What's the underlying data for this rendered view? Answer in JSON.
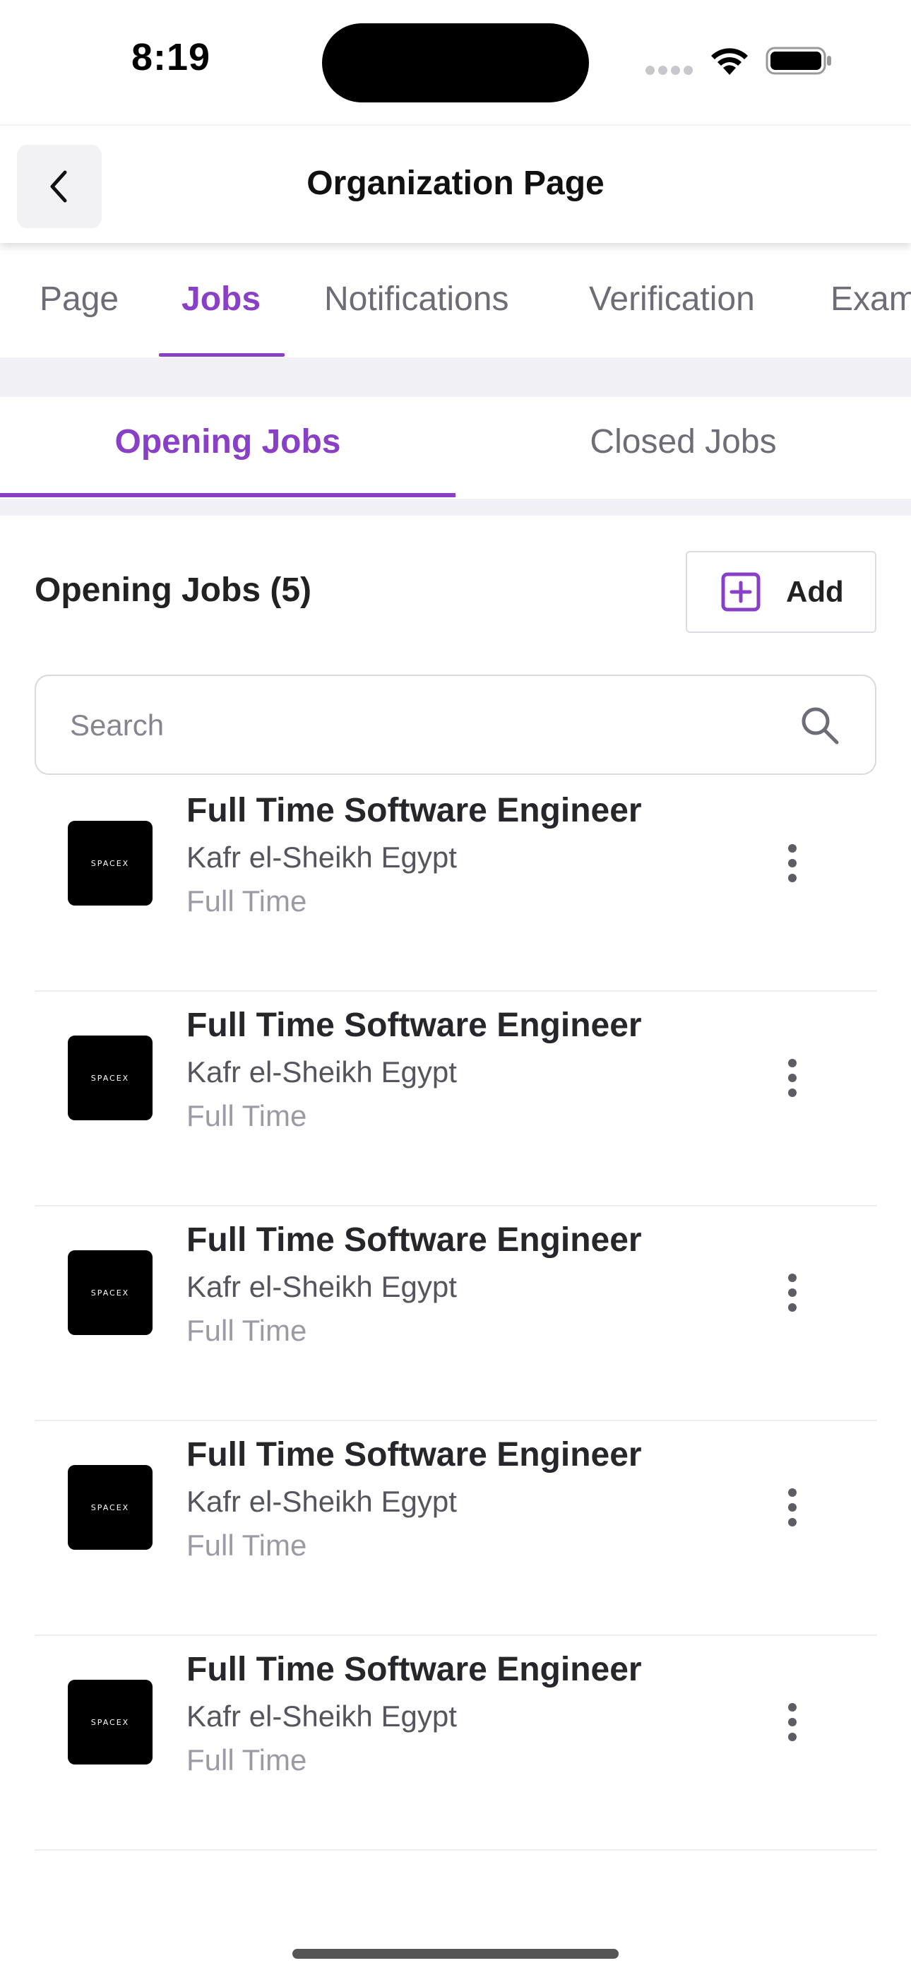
{
  "status_bar": {
    "time": "8:19"
  },
  "header": {
    "title": "Organization Page"
  },
  "primary_tabs": [
    {
      "label": "Page",
      "active": false
    },
    {
      "label": "Jobs",
      "active": true
    },
    {
      "label": "Notifications",
      "active": false
    },
    {
      "label": "Verification",
      "active": false
    },
    {
      "label": "Exam",
      "active": false
    }
  ],
  "secondary_tabs": [
    {
      "label": "Opening Jobs",
      "active": true
    },
    {
      "label": "Closed Jobs",
      "active": false
    }
  ],
  "section": {
    "title": "Opening Jobs (5)",
    "add_label": "Add"
  },
  "search": {
    "placeholder": "Search",
    "value": ""
  },
  "jobs": [
    {
      "title": "Full Time Software Engineer",
      "location": "Kafr el-Sheikh Egypt",
      "type": "Full Time",
      "logo_text": "SPACEX"
    },
    {
      "title": "Full Time Software Engineer",
      "location": "Kafr el-Sheikh Egypt",
      "type": "Full Time",
      "logo_text": "SPACEX"
    },
    {
      "title": "Full Time Software Engineer",
      "location": "Kafr el-Sheikh Egypt",
      "type": "Full Time",
      "logo_text": "SPACEX"
    },
    {
      "title": "Full Time Software Engineer",
      "location": "Kafr el-Sheikh Egypt",
      "type": "Full Time",
      "logo_text": "SPACEX"
    },
    {
      "title": "Full Time Software Engineer",
      "location": "Kafr el-Sheikh Egypt",
      "type": "Full Time",
      "logo_text": "SPACEX"
    }
  ],
  "colors": {
    "accent": "#8a3fc7",
    "text_primary": "#26262b",
    "text_secondary": "#55555f",
    "text_muted": "#9b9ba5",
    "band": "#f1f1f5"
  },
  "icons": {
    "back": "chevron-left-icon",
    "add": "plus-square-icon",
    "search": "search-icon",
    "more": "more-vertical-icon",
    "wifi": "wifi-icon",
    "battery": "battery-icon"
  }
}
